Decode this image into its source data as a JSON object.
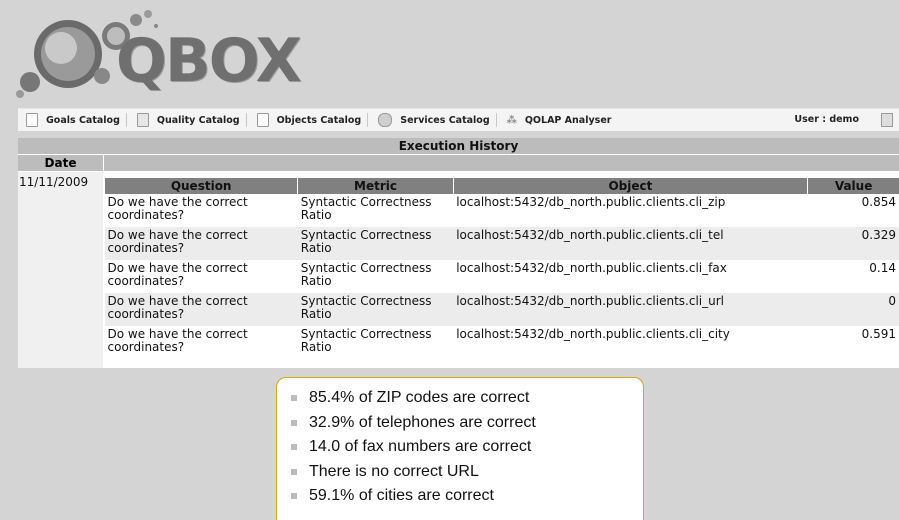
{
  "app": {
    "logo_text": "QBOX"
  },
  "menu": {
    "items": [
      {
        "label": "Goals Catalog",
        "icon": "document-icon"
      },
      {
        "label": "Quality Catalog",
        "icon": "folder-icon"
      },
      {
        "label": "Objects Catalog",
        "icon": "list-icon"
      },
      {
        "label": "Services Catalog",
        "icon": "gear-icon"
      },
      {
        "label": "QOLAP Analyser",
        "icon": "chart-icon"
      }
    ],
    "user": "User : demo"
  },
  "history": {
    "title": "Execution History",
    "date_header": "Date",
    "date": "11/11/2009",
    "columns": [
      "Question",
      "Metric",
      "Object",
      "Value"
    ],
    "rows": [
      {
        "question": "Do we have the correct coordinates?",
        "metric": "Syntactic Correctness Ratio",
        "object": "localhost:5432/db_north.public.clients.cli_zip",
        "value": "0.854"
      },
      {
        "question": "Do we have the correct coordinates?",
        "metric": "Syntactic Correctness Ratio",
        "object": "localhost:5432/db_north.public.clients.cli_tel",
        "value": "0.329"
      },
      {
        "question": "Do we have the correct coordinates?",
        "metric": "Syntactic Correctness Ratio",
        "object": "localhost:5432/db_north.public.clients.cli_fax",
        "value": "0.14"
      },
      {
        "question": "Do we have the correct coordinates?",
        "metric": "Syntactic Correctness Ratio",
        "object": "localhost:5432/db_north.public.clients.cli_url",
        "value": "0"
      },
      {
        "question": "Do we have the correct coordinates?",
        "metric": "Syntactic Correctness Ratio",
        "object": "localhost:5432/db_north.public.clients.cli_city",
        "value": "0.591"
      }
    ]
  },
  "callout": {
    "items": [
      "85.4% of ZIP codes are correct",
      "32.9% of telephones are correct",
      "14.0 of fax numbers are correct",
      "There is no correct URL",
      "59.1% of cities are correct"
    ]
  },
  "colors": {
    "accent": "#e3a21a",
    "header_bg": "#bcbcbc",
    "col_header_bg": "#808080"
  }
}
